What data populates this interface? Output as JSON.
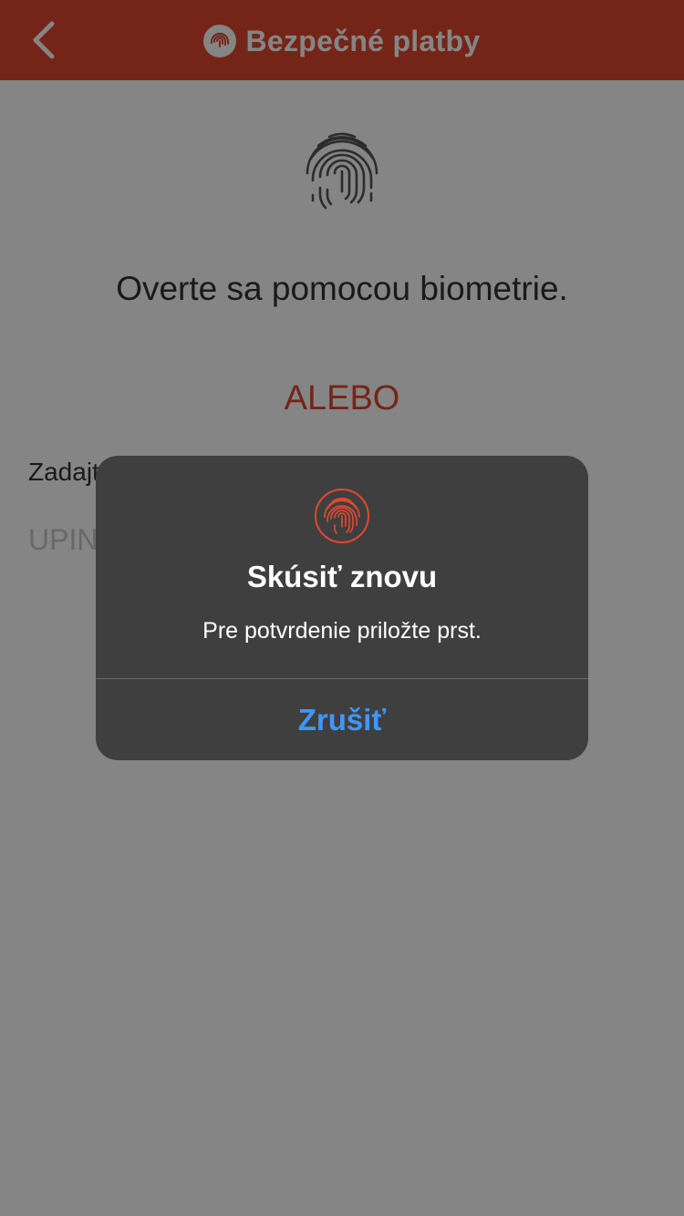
{
  "header": {
    "title": "Bezpečné platby",
    "back_icon": "chevron-left-icon",
    "logo_icon": "fingerprint-icon"
  },
  "main": {
    "fingerprint_icon": "fingerprint-icon",
    "biometric_text": "Overte sa pomocou biometrie.",
    "separator_text": "ALEBO",
    "pin_label": "Zadajt",
    "pin_placeholder": "UPIN"
  },
  "dialog": {
    "icon": "fingerprint-icon",
    "title": "Skúsiť znovu",
    "message": "Pre potvrdenie priložte prst.",
    "cancel_label": "Zrušiť"
  },
  "colors": {
    "brand": "#e0482f",
    "dialog_bg": "#3f3f3f",
    "cancel_blue": "#3f96ff"
  }
}
